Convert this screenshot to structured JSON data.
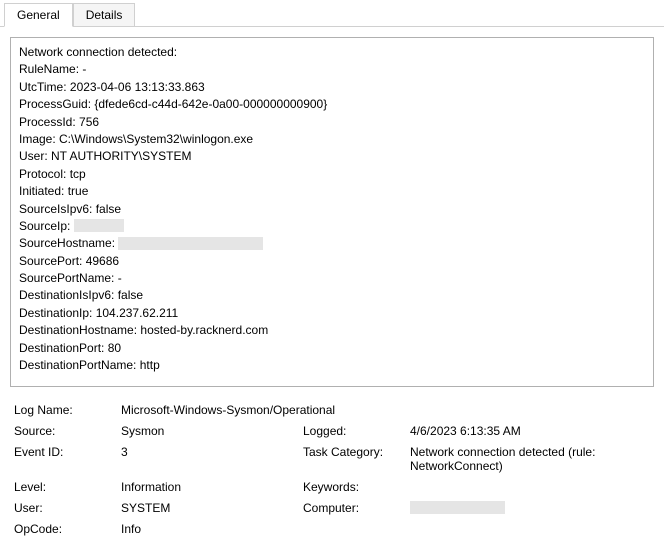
{
  "tabs": {
    "general": "General",
    "details": "Details"
  },
  "message": {
    "title": "Network connection detected:",
    "lines": [
      {
        "k": "RuleName",
        "v": "-"
      },
      {
        "k": "UtcTime",
        "v": "2023-04-06 13:13:33.863"
      },
      {
        "k": "ProcessGuid",
        "v": "{dfede6cd-c44d-642e-0a00-000000000900}"
      },
      {
        "k": "ProcessId",
        "v": "756"
      },
      {
        "k": "Image",
        "v": "C:\\Windows\\System32\\winlogon.exe"
      },
      {
        "k": "User",
        "v": "NT AUTHORITY\\SYSTEM"
      },
      {
        "k": "Protocol",
        "v": "tcp"
      },
      {
        "k": "Initiated",
        "v": "true"
      },
      {
        "k": "SourceIsIpv6",
        "v": "false"
      },
      {
        "k": "SourceIp",
        "v": "",
        "redact": "s1"
      },
      {
        "k": "SourceHostname",
        "v": "",
        "redact": "s2"
      },
      {
        "k": "SourcePort",
        "v": "49686"
      },
      {
        "k": "SourcePortName",
        "v": "-"
      },
      {
        "k": "DestinationIsIpv6",
        "v": "false"
      },
      {
        "k": "DestinationIp",
        "v": "104.237.62.211"
      },
      {
        "k": "DestinationHostname",
        "v": "hosted-by.racknerd.com"
      },
      {
        "k": "DestinationPort",
        "v": "80"
      },
      {
        "k": "DestinationPortName",
        "v": "http"
      }
    ]
  },
  "meta": {
    "log_name_label": "Log Name:",
    "log_name_value": "Microsoft-Windows-Sysmon/Operational",
    "source_label": "Source:",
    "source_value": "Sysmon",
    "logged_label": "Logged:",
    "logged_value": "4/6/2023 6:13:35 AM",
    "event_id_label": "Event ID:",
    "event_id_value": "3",
    "task_cat_label": "Task Category:",
    "task_cat_value": "Network connection detected (rule: NetworkConnect)",
    "level_label": "Level:",
    "level_value": "Information",
    "keywords_label": "Keywords:",
    "keywords_value": "",
    "user_label": "User:",
    "user_value": "SYSTEM",
    "computer_label": "Computer:",
    "computer_redact": "s3",
    "opcode_label": "OpCode:",
    "opcode_value": "Info"
  }
}
